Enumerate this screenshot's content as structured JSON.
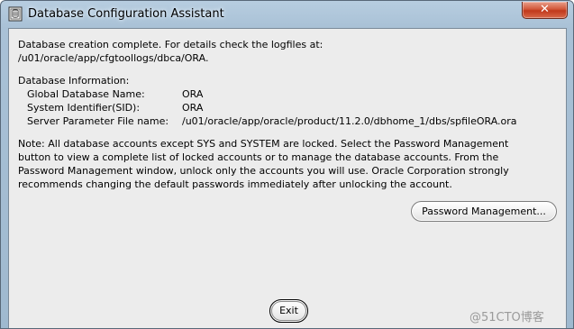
{
  "window": {
    "title": "Database Configuration Assistant",
    "close_symbol": "✕"
  },
  "message": {
    "line1": "Database creation complete. For details check the logfiles at:",
    "line2": " /u01/oracle/app/cfgtoollogs/dbca/ORA."
  },
  "db_info": {
    "heading": "Database Information:",
    "rows": [
      {
        "label": "Global Database Name:",
        "value": "ORA"
      },
      {
        "label": "System Identifier(SID):",
        "value": "ORA"
      },
      {
        "label": "Server Parameter File name:",
        "value": "/u01/oracle/app/oracle/product/11.2.0/dbhome_1/dbs/spfileORA.ora"
      }
    ]
  },
  "note": {
    "lines": [
      "Note: All database accounts except SYS and SYSTEM are locked. Select the Password Management",
      "button to view a complete list of locked accounts or to manage the database accounts. From the",
      "Password Management window, unlock only the accounts you will use. Oracle Corporation strongly",
      "recommends changing the default passwords immediately after unlocking the account."
    ]
  },
  "buttons": {
    "password_management": "Password Management...",
    "exit": "Exit"
  },
  "watermark": "@51CTO博客",
  "icons": {
    "title": "dbca-app-icon",
    "close": "close-icon"
  },
  "colors": {
    "window_frame": "#a9c1d6",
    "panel_background": "#ececec",
    "close_button": "#c8452a"
  }
}
